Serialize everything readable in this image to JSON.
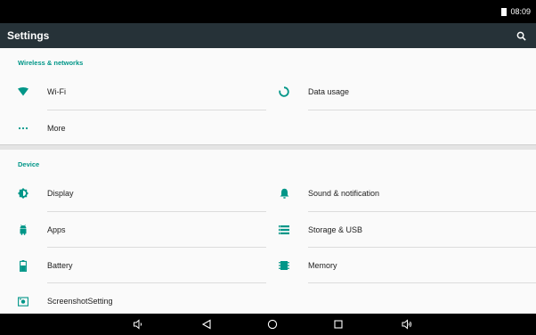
{
  "status_bar": {
    "time": "08:09"
  },
  "toolbar": {
    "title": "Settings"
  },
  "sections": {
    "wireless": {
      "header": "Wireless & networks",
      "wifi": "Wi-Fi",
      "data_usage": "Data usage",
      "more": "More"
    },
    "device": {
      "header": "Device",
      "display": "Display",
      "sound": "Sound & notification",
      "apps": "Apps",
      "storage": "Storage & USB",
      "battery": "Battery",
      "memory": "Memory",
      "screenshot": "ScreenshotSetting"
    }
  },
  "colors": {
    "accent": "#009688",
    "toolbar": "#263238",
    "text": "#212121"
  },
  "icons": {
    "wifi": "wifi-icon",
    "data_usage": "data-usage-icon",
    "more": "more-icon",
    "display": "display-icon",
    "sound": "bell-icon",
    "apps": "android-icon",
    "storage": "storage-icon",
    "battery": "battery-icon",
    "memory": "memory-icon",
    "screenshot": "screenshot-icon"
  }
}
